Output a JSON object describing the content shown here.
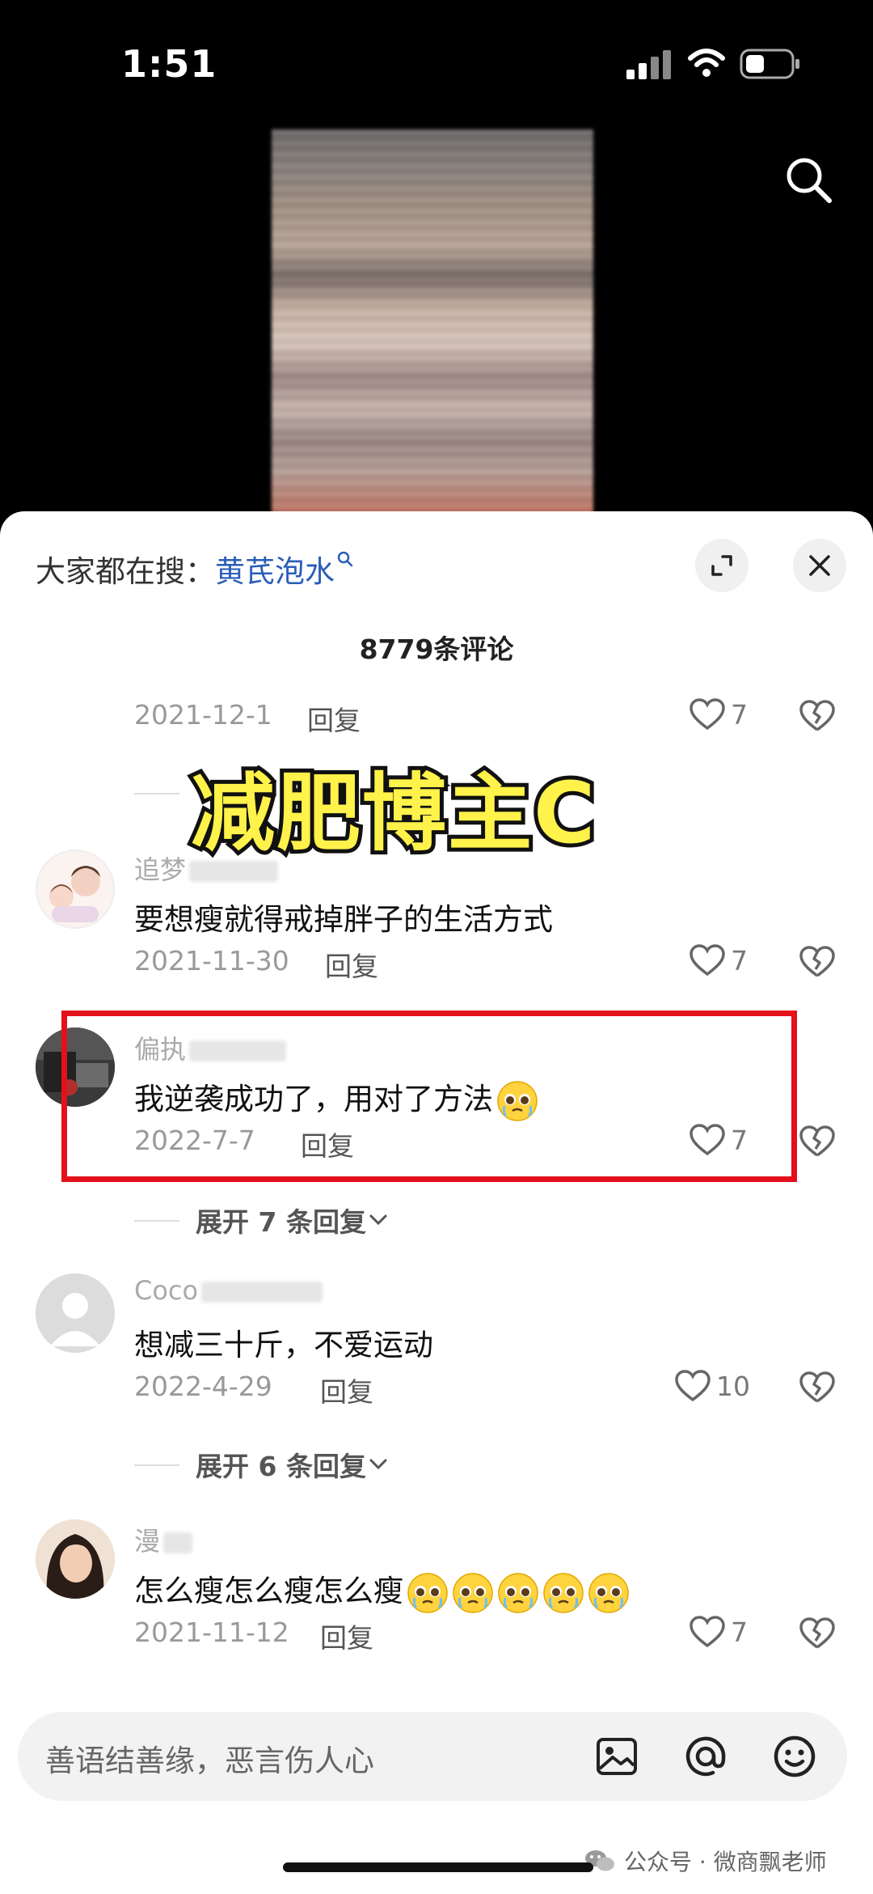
{
  "status_bar": {
    "time": "1:51"
  },
  "hot_search": {
    "prefix": "大家都在搜：",
    "keyword": "黄芪泡水"
  },
  "comment_count": "8779条评论",
  "overlay_title": "减肥博主C",
  "comments": [
    {
      "date": "2021-12-1",
      "reply": "回复",
      "likes": "7"
    },
    {
      "username": "追梦",
      "text": "要想瘦就得戒掉胖子的生活方式",
      "date": "2021-11-30",
      "reply": "回复",
      "likes": "7"
    },
    {
      "username": "偏执",
      "text": "我逆袭成功了，用对了方法",
      "date": "2022-7-7",
      "reply": "回复",
      "likes": "7",
      "expand_replies": "展开 7 条回复"
    },
    {
      "username": "Coco",
      "text": "想减三十斤，不爱运动",
      "date": "2022-4-29",
      "reply": "回复",
      "likes": "10",
      "expand_replies": "展开 6 条回复"
    },
    {
      "username": "漫",
      "text": "怎么瘦怎么瘦怎么瘦",
      "date": "2021-11-12",
      "reply": "回复",
      "likes": "7"
    }
  ],
  "input": {
    "placeholder": "善语结善缘，恶言伤人心"
  },
  "watermark": "公众号 · 微商飘老师",
  "colors": {
    "highlight": "#e3111b",
    "overlay_text": "#fff24a",
    "keyword": "#2a5db8"
  },
  "icons": [
    "search-icon",
    "expand-icon",
    "close-icon",
    "heart-icon",
    "broken-heart-icon",
    "image-icon",
    "at-icon",
    "emoji-icon"
  ]
}
